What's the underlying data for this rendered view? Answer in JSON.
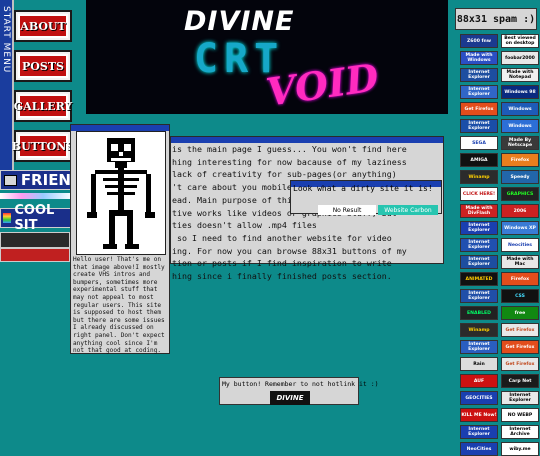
{
  "sidebar": {
    "start_menu_label": "START MENU",
    "nav": [
      {
        "label": "ABOUT"
      },
      {
        "label": "POSTS"
      },
      {
        "label": "GALLERY"
      },
      {
        "label": "BUTTONS"
      }
    ],
    "friends_label": "FRIEN",
    "cool_sites_label": "COOL SIT"
  },
  "header": {
    "logo_line1": "DIVINE",
    "logo_line2": "CRT",
    "logo_line3": "VOID"
  },
  "main_window": {
    "text": "is the main page I guess... You won't find here\nhing interesting for now bacause of my laziness\nlack of creativity for sub-pages(or anything)\n't care about you mobile users so just use PC\nead. Main purpose of this site\ntive works like videos or graphics stuff, but\nties doesn't allow .mp4 files\n so I need to find another website for video\ning. For now you can browse 88x31 buttons of my\ntion or posts if I find inspiration to write\nhing since i finally finished posts section."
  },
  "popup": {
    "title": "Look what a dirty site it is!",
    "no_result_label": "No Result",
    "carbon_label": "Website Carbon"
  },
  "skeleton_window": {
    "text": "Hello user! That's me on\nthat image above!I mostly\ncreate VHS intros and\nbumpers, sometimes more\nexperimental stuff that\nmay not appeal to most\nregular users. This site\nis supposed to host them\nbut there are some issues\nI already discussed on\nright panel. Don't expect\nanything cool since I'm\nnot that good at coding."
  },
  "footer": {
    "text": "My button! Remember to not hotlink it :)",
    "button_label": "DIVINE"
  },
  "spam": {
    "title": "88x31 spam :)",
    "buttons": [
      {
        "label": "Z600 fnw",
        "bg": "#1b3a8f",
        "fg": "#ffffff"
      },
      {
        "label": "Best viewed on desktop",
        "bg": "#ffffff",
        "fg": "#000000"
      },
      {
        "label": "Made with Windows",
        "bg": "#2b4fc4",
        "fg": "#ffffff"
      },
      {
        "label": "foobar2000",
        "bg": "#e8e8e8",
        "fg": "#000000"
      },
      {
        "label": "Internet Explorer",
        "bg": "#1d4ea0",
        "fg": "#ffffff"
      },
      {
        "label": "Made with Notepad",
        "bg": "#f0f0f0",
        "fg": "#000000"
      },
      {
        "label": "Internet Explorer",
        "bg": "#3166c8",
        "fg": "#ffffff"
      },
      {
        "label": "Windows 98",
        "bg": "#0a2a80",
        "fg": "#ffffff"
      },
      {
        "label": "Get Firefox",
        "bg": "#e24d1c",
        "fg": "#ffffff"
      },
      {
        "label": "Windows",
        "bg": "#1e5bb8",
        "fg": "#ffffff"
      },
      {
        "label": "Internet Explorer",
        "bg": "#1a4ea8",
        "fg": "#ffffff"
      },
      {
        "label": "Windows",
        "bg": "#2c6fd6",
        "fg": "#ffffff"
      },
      {
        "label": "SEGA",
        "bg": "#ffffff",
        "fg": "#1a3fb0"
      },
      {
        "label": "Made By Netscape",
        "bg": "#3a3a3a",
        "fg": "#ffffff"
      },
      {
        "label": "AMIGA",
        "bg": "#111111",
        "fg": "#ffffff"
      },
      {
        "label": "Firefox",
        "bg": "#e87e1e",
        "fg": "#ffffff"
      },
      {
        "label": "Winamp",
        "bg": "#2b2b2b",
        "fg": "#ffd000"
      },
      {
        "label": "Speedy",
        "bg": "#2266aa",
        "fg": "#ffffff"
      },
      {
        "label": "CLICK HERE!",
        "bg": "#ffffff",
        "fg": "#c01010"
      },
      {
        "label": "GRAPHICS",
        "bg": "#222222",
        "fg": "#22ff22"
      },
      {
        "label": "Made with DivFlash",
        "bg": "#cc2222",
        "fg": "#ffffff"
      },
      {
        "label": "2006",
        "bg": "#cc2222",
        "fg": "#ffffff"
      },
      {
        "label": "Internet Explorer",
        "bg": "#1a3fb0",
        "fg": "#ffffff"
      },
      {
        "label": "Windows XP",
        "bg": "#3a7bd5",
        "fg": "#ffffff"
      },
      {
        "label": "Internet Explorer",
        "bg": "#2050b0",
        "fg": "#ffffff"
      },
      {
        "label": "Neocities",
        "bg": "#ffffff",
        "fg": "#1a3fb0"
      },
      {
        "label": "Internet Explorer",
        "bg": "#1d4ea0",
        "fg": "#ffffff"
      },
      {
        "label": "Made with Mac",
        "bg": "#e8e8e8",
        "fg": "#000000"
      },
      {
        "label": "ANIMATED",
        "bg": "#111111",
        "fg": "#ffcc00"
      },
      {
        "label": "Firefox",
        "bg": "#e24d1c",
        "fg": "#ffffff"
      },
      {
        "label": "Internet Explorer",
        "bg": "#204fa8",
        "fg": "#ffffff"
      },
      {
        "label": "CSS",
        "bg": "#111111",
        "fg": "#44ddff"
      },
      {
        "label": "ENABLED",
        "bg": "#222222",
        "fg": "#00ff66"
      },
      {
        "label": "free",
        "bg": "#118811",
        "fg": "#ffffff"
      },
      {
        "label": "Winamp",
        "bg": "#2b2b2b",
        "fg": "#ffd000"
      },
      {
        "label": "Get Firefox",
        "bg": "#e8e8e8",
        "fg": "#c0471c"
      },
      {
        "label": "Internet Explorer",
        "bg": "#2a5ec0",
        "fg": "#ffffff"
      },
      {
        "label": "Get Firefox",
        "bg": "#e24d1c",
        "fg": "#ffffff"
      },
      {
        "label": "Rain",
        "bg": "#dddddd",
        "fg": "#000000"
      },
      {
        "label": "Get Firefox",
        "bg": "#e8e8e8",
        "fg": "#c0471c"
      },
      {
        "label": "AUF",
        "bg": "#cc1111",
        "fg": "#ffffff"
      },
      {
        "label": "Carp Net",
        "bg": "#1a1a1a",
        "fg": "#ffffff"
      },
      {
        "label": "GEOCITIES",
        "bg": "#1a3fb0",
        "fg": "#ffffff"
      },
      {
        "label": "Internet Explorer",
        "bg": "#e8e8e8",
        "fg": "#000000"
      },
      {
        "label": "KILL ME Now!",
        "bg": "#cc1111",
        "fg": "#ffffff"
      },
      {
        "label": "NO WEBP",
        "bg": "#ffffff",
        "fg": "#000000"
      },
      {
        "label": "Internet Explorer",
        "bg": "#1a3fb0",
        "fg": "#ffffff"
      },
      {
        "label": "Internet Archive",
        "bg": "#ffffff",
        "fg": "#000000"
      },
      {
        "label": "NeoCities",
        "bg": "#1a3fb0",
        "fg": "#ffffff"
      },
      {
        "label": "wiby.me",
        "bg": "#ffffff",
        "fg": "#000000"
      }
    ]
  }
}
